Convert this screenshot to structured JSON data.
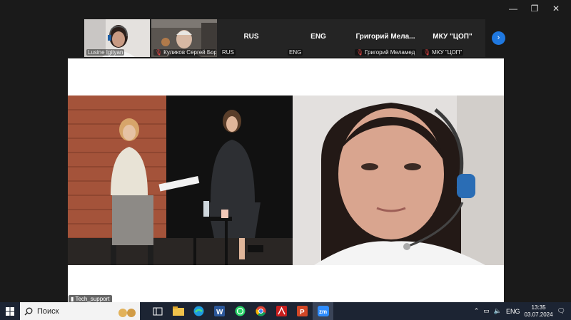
{
  "window": {
    "minimize_glyph": "—",
    "restore_glyph": "❐",
    "close_glyph": "✕"
  },
  "strip": {
    "tiles": [
      {
        "kind": "video",
        "name": "Lusine Igityan",
        "muted": false
      },
      {
        "kind": "video",
        "name": "Куликов Сергей Бор...",
        "muted": true
      },
      {
        "kind": "label",
        "center": "RUS",
        "name": "RUS",
        "muted": false
      },
      {
        "kind": "label",
        "center": "ENG",
        "name": "ENG",
        "muted": false
      },
      {
        "kind": "label",
        "center": "Григорий  Мела...",
        "name": "Григорий Меламед",
        "muted": true
      },
      {
        "kind": "label",
        "center": "МКУ \"ЦОП\"",
        "name": "МКУ \"ЦОП\"",
        "muted": true
      }
    ],
    "next_icon": "chevron-right-icon"
  },
  "share": {
    "tech_label": "Tech_support"
  },
  "taskbar": {
    "search_placeholder": "Поиск",
    "lang": "ENG",
    "time": "13:35",
    "date": "03.07.2024",
    "apps": [
      "task-view-icon",
      "file-explorer-icon",
      "edge-icon",
      "word-icon",
      "whatsapp-icon",
      "chrome-icon",
      "acrobat-icon",
      "powerpoint-icon",
      "zoom-icon"
    ]
  },
  "colors": {
    "accent": "#1f78e0",
    "muted_red": "#e84545",
    "taskbar": "#1c2433"
  }
}
